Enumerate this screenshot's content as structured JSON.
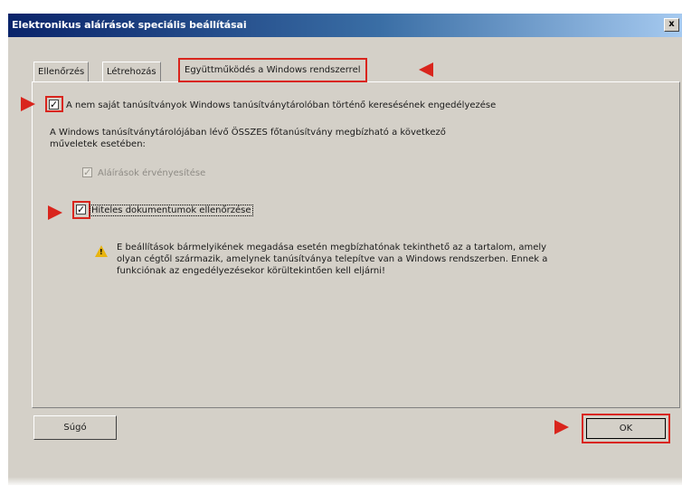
{
  "window": {
    "title": "Elektronikus aláírások speciális beállításai",
    "close_glyph": "x"
  },
  "tabs": [
    {
      "label": "Ellenőrzés",
      "active": false
    },
    {
      "label": "Létrehozás",
      "active": false
    },
    {
      "label": "Együttműködés a Windows rendszerrel",
      "active": true
    }
  ],
  "options": {
    "search_label": "A nem saját tanúsítványok Windows tanúsítványtárolóban történő keresésének engedélyezése",
    "search_checked": true,
    "trust_intro_line1": "A Windows tanúsítványtárolójában lévő ÖSSZES főtanúsítvány megbízható a következő",
    "trust_intro_line2": "műveletek esetében:",
    "validate_signatures_label": "Aláírások érvényesítése",
    "validate_signatures_checked": true,
    "validate_signatures_enabled": false,
    "certified_docs_label": "Hiteles dokumentumok ellenőrzése",
    "certified_docs_checked": true
  },
  "warning": {
    "icon": "warning-triangle-icon",
    "line1": "E beállítások bármelyikének megadása esetén megbízhatónak tekinthető az a tartalom, amely",
    "line2": "olyan cégtől származik, amelynek tanúsítványa telepítve van a Windows rendszerben. Ennek a",
    "line3": "funkciónak az engedélyezésekor körültekintően kell eljárni!"
  },
  "buttons": {
    "help_label": "Súgó",
    "ok_label": "OK"
  },
  "colors": {
    "highlight": "#d9251d",
    "dialog_bg": "#d4d0c8",
    "titlebar": "#0a246a"
  },
  "check_glyph": "✓"
}
